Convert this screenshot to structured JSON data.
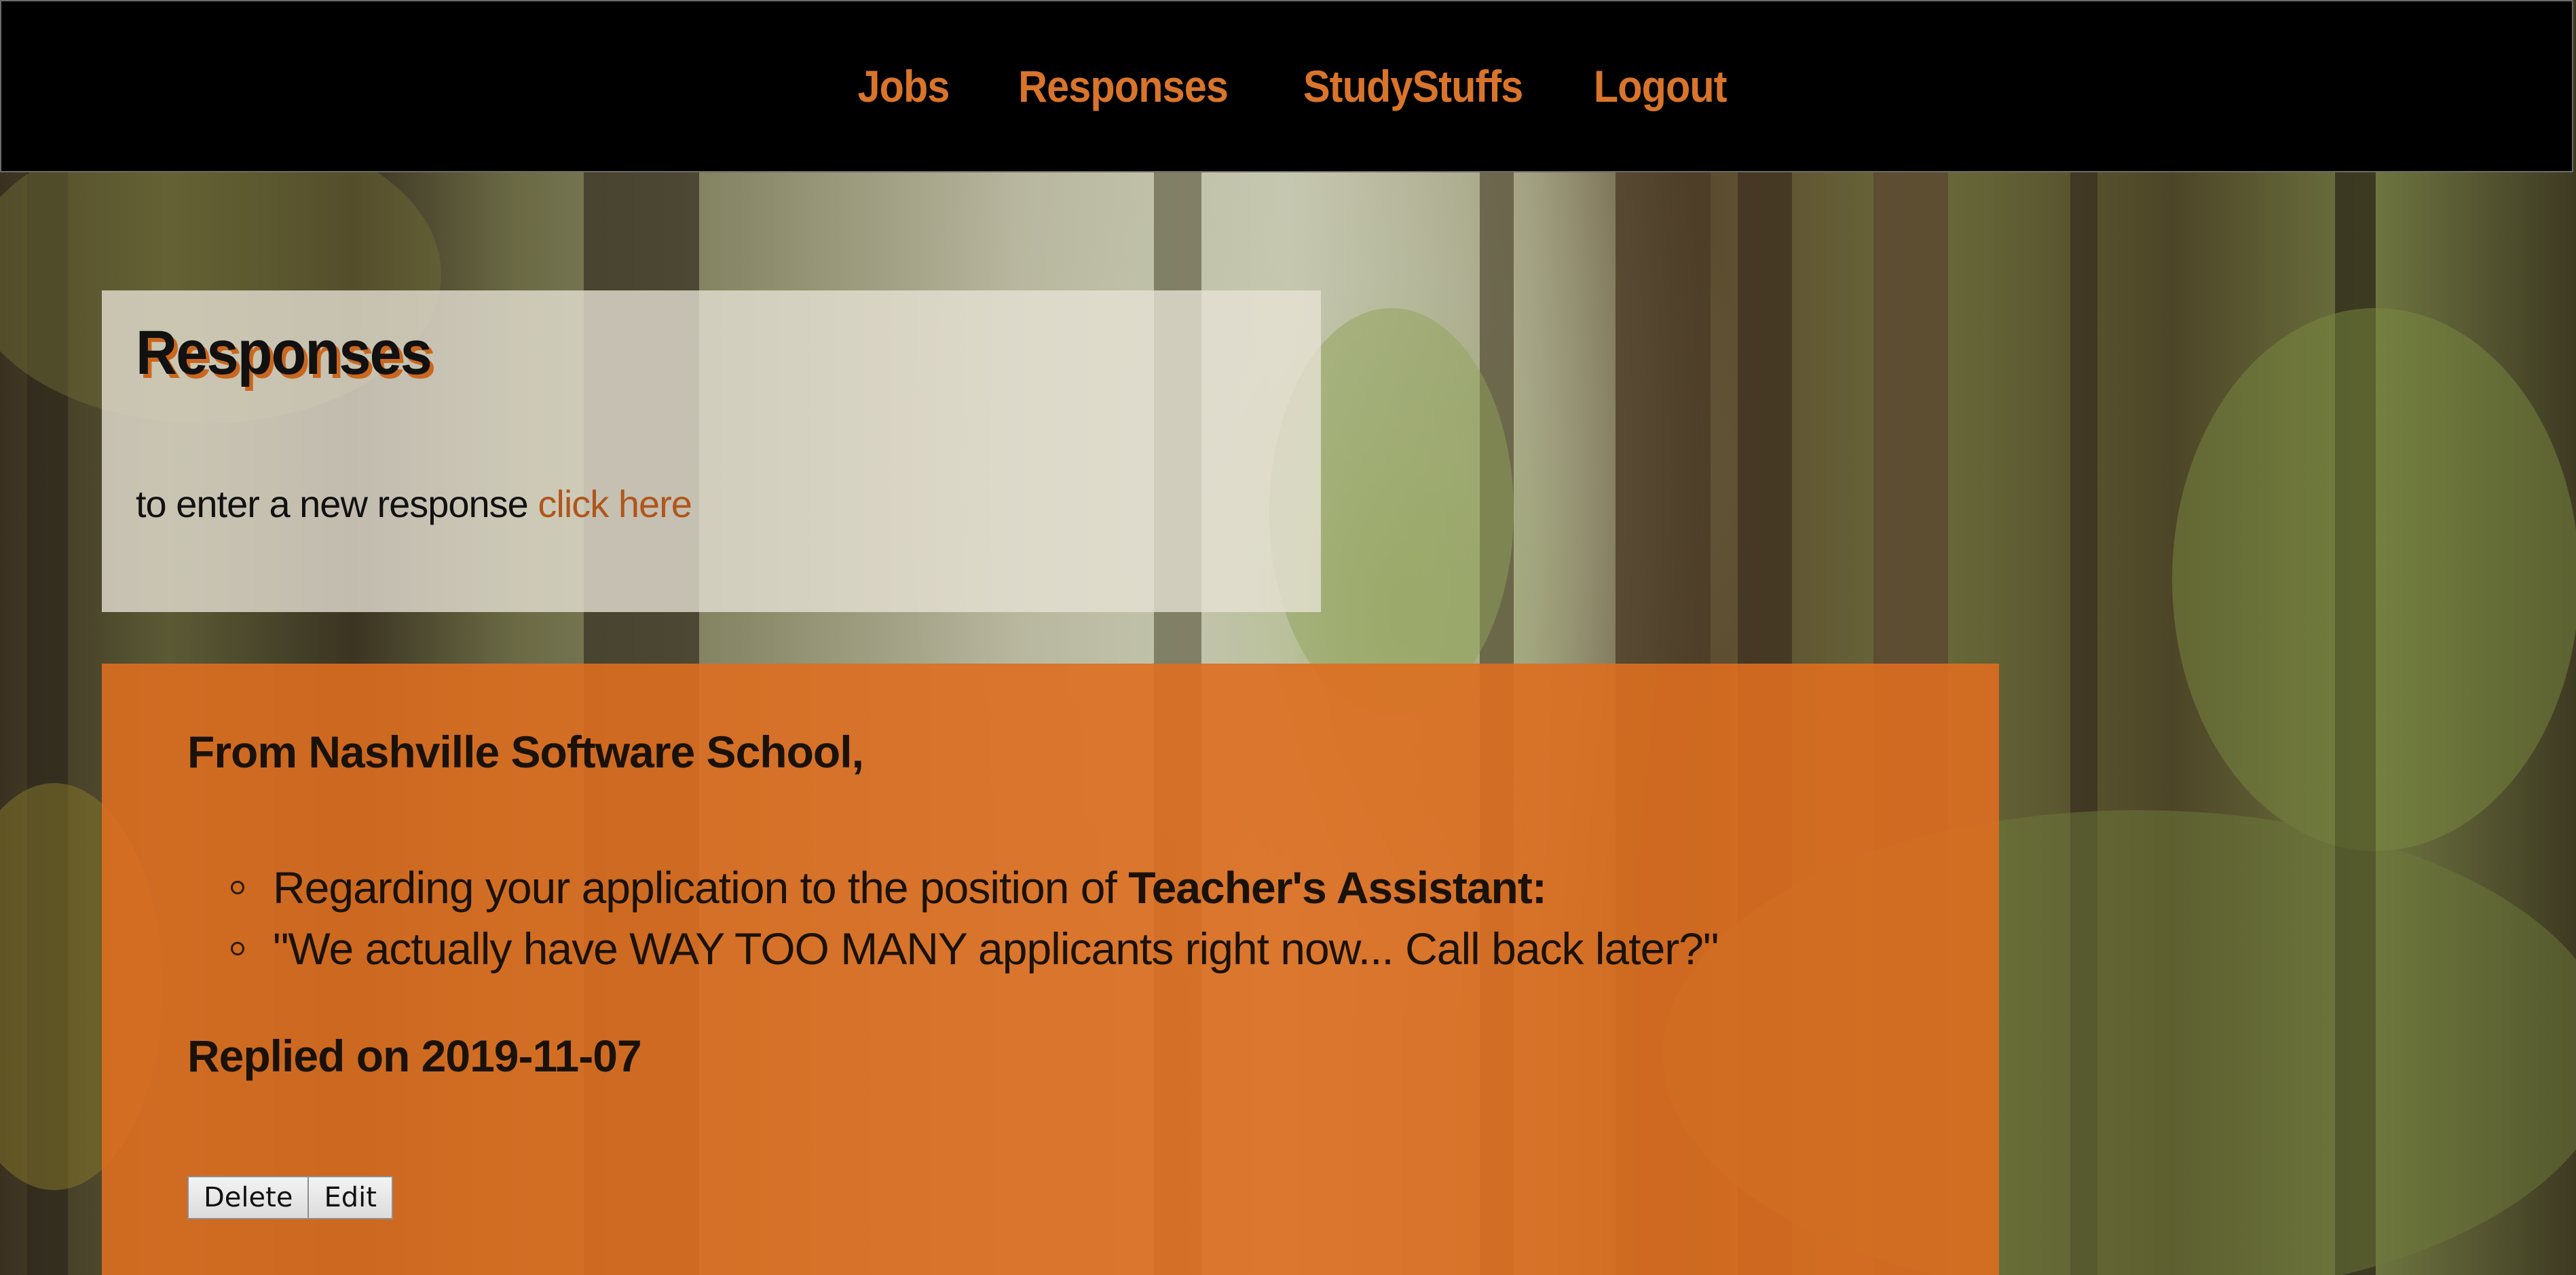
{
  "nav": {
    "items": [
      {
        "label": "Jobs"
      },
      {
        "label": "Responses"
      },
      {
        "label": "StudyStuffs"
      },
      {
        "label": "Logout"
      }
    ]
  },
  "header": {
    "title": "Responses",
    "intro_text": "to enter a new response",
    "intro_link": "click here"
  },
  "response": {
    "from": "From Nashville Software School,",
    "regarding_prefix": "Regarding your application to the position of",
    "position": "Teacher's Assistant:",
    "message": "\"We actually have WAY TOO MANY applicants right now... Call back later?\"",
    "replied": "Replied on 2019-11-07",
    "delete_label": "Delete",
    "edit_label": "Edit"
  },
  "colors": {
    "accent": "#d9742b",
    "card_bg": "#dd6e20",
    "nav_bg": "#000000"
  }
}
